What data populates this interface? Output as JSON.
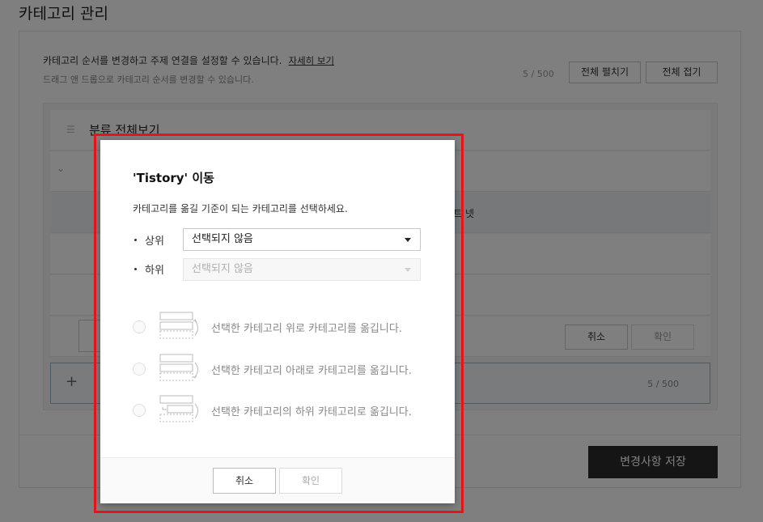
{
  "page": {
    "title": "카테고리 관리",
    "description": "카테고리 순서를 변경하고 주제 연결을 설정할 수 있습니다.",
    "detail_link": "자세히 보기",
    "drag_hint": "드래그 앤 드롭으로 카테고리 순서를 변경할 수 있습니다.",
    "count_top": "5 / 500",
    "expand_all": "전체 펼치기",
    "collapse_all": "전체 접기"
  },
  "category_list": {
    "all_label": "분류 전체보기",
    "row3_suffix": "트 넷",
    "row_cancel": "취소",
    "row_confirm": "확인",
    "count_bottom": "5 / 500",
    "add_plus": "+"
  },
  "save_button": "변경사항 저장",
  "dialog": {
    "title": "'Tistory' 이동",
    "description": "카테고리를 옮길 기준이 되는 카테고리를 선택하세요.",
    "upper_label": "상위",
    "upper_value": "선택되지 않음",
    "lower_label": "하위",
    "lower_value": "선택되지 않음",
    "options": [
      {
        "label": "선택한 카테고리 위로 카테고리를 옮깁니다."
      },
      {
        "label": "선택한 카테고리 아래로 카테고리를 옮깁니다."
      },
      {
        "label": "선택한 카테고리의 하위 카테고리로 옮깁니다."
      }
    ],
    "cancel": "취소",
    "confirm": "확인"
  },
  "colors": {
    "highlight": "#e8141b",
    "save_bg": "#2b2b2b",
    "overlay": "rgba(0,0,0,0.5)"
  }
}
